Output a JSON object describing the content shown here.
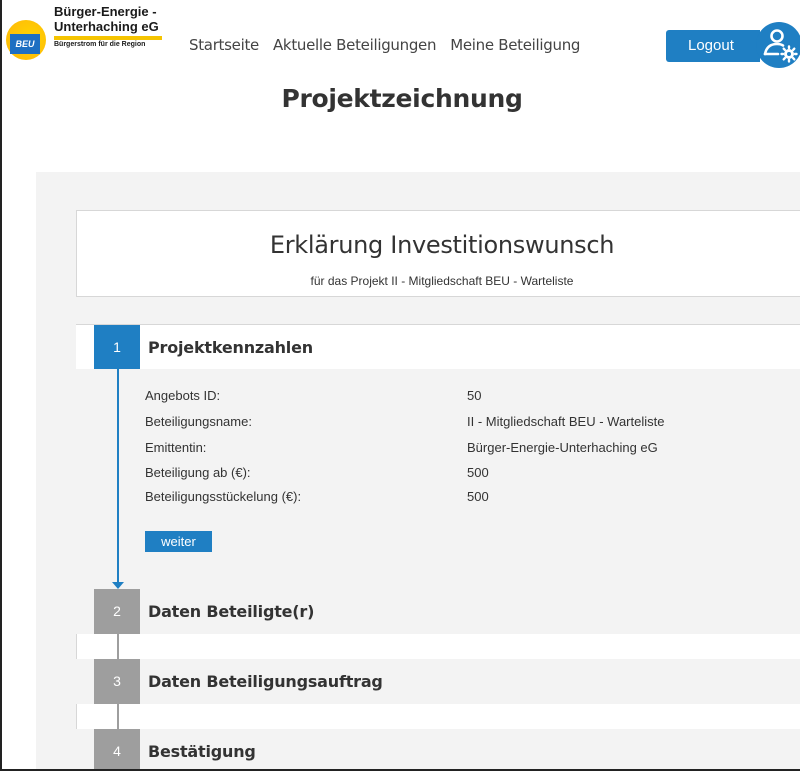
{
  "brand": {
    "badge": "BEU",
    "line1": "Bürger-Energie -",
    "line2": "Unterhaching eG",
    "tagline": "Bürgerstrom für die Region",
    "accent": "#1f7fc3",
    "sun": "#ffc107"
  },
  "nav": {
    "items": [
      "Startseite",
      "Aktuelle Beteiligungen",
      "Meine Beteiligung"
    ]
  },
  "header": {
    "logout_label": "Logout",
    "user_icon": "user-settings-icon"
  },
  "page": {
    "title": "Projektzeichnung"
  },
  "declaration": {
    "title": "Erklärung Investitionswunsch",
    "subtitle": "für das Projekt II - Mitgliedschaft BEU - Warteliste"
  },
  "steps": [
    {
      "number": "1",
      "label": "Projektkennzahlen",
      "active": true
    },
    {
      "number": "2",
      "label": "Daten Beteiligte(r)",
      "active": false
    },
    {
      "number": "3",
      "label": "Daten Beteiligungsauftrag",
      "active": false
    },
    {
      "number": "4",
      "label": "Bestätigung",
      "active": false
    }
  ],
  "details": [
    {
      "key": "Angebots ID:",
      "value": "50"
    },
    {
      "key": "Beteiligungsname:",
      "value": "II - Mitgliedschaft BEU - Warteliste"
    },
    {
      "key": "Emittentin:",
      "value": "Bürger-Energie-Unterhaching eG"
    },
    {
      "key": "Beteiligung ab (€):",
      "value": "500"
    },
    {
      "key": "Beteiligungsstückelung (€):",
      "value": "500"
    }
  ],
  "actions": {
    "next_label": "weiter"
  },
  "colors": {
    "active_step": "#1f7fc3",
    "inactive_step": "#9e9e9e",
    "panel_bg": "#f3f3f3"
  }
}
